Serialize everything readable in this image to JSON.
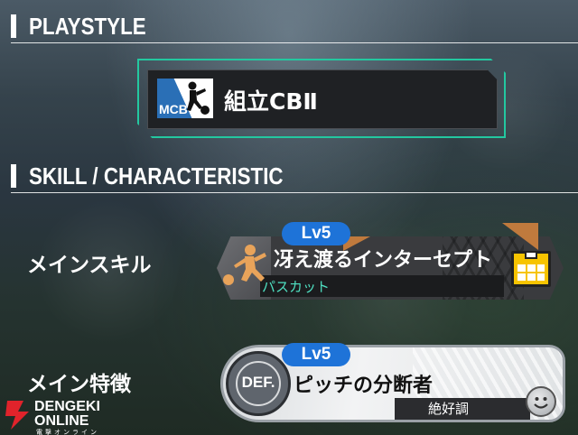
{
  "sections": {
    "playstyle_title": "PLAYSTYLE",
    "skill_title": "SKILL / CHARACTERISTIC"
  },
  "playstyle": {
    "role_code": "MCB",
    "name": "組立CBⅡ"
  },
  "main_skill": {
    "label": "メインスキル",
    "level": "Lv5",
    "name": "冴え渡るインターセプト",
    "category": "パスカット",
    "icon": "kicking-player-icon",
    "secondary_icon": "pitch-formation-icon"
  },
  "main_characteristic": {
    "label": "メイン特徴",
    "level": "Lv5",
    "badge": "DEF.",
    "name": "ピッチの分断者",
    "condition": "絶好調",
    "icon": "smiley-face-icon"
  },
  "watermark": {
    "line1": "DENGEKI",
    "line2": "ONLINE",
    "line3": "電撃オンライン"
  },
  "colors": {
    "accent_teal": "#23c8a0",
    "level_blue": "#1e73d8",
    "skill_orange": "#c07a3d",
    "pitch_yellow": "#f7c400",
    "watermark_red": "#e0232b"
  }
}
